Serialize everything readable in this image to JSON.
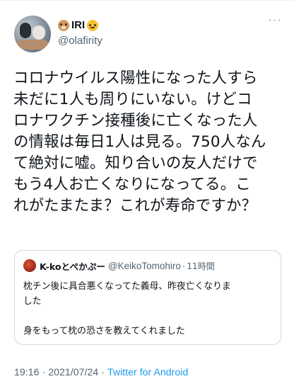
{
  "tweet": {
    "author": {
      "display_name": "IRI",
      "name_emoji_left": "dog-face",
      "name_emoji_right": "cat-face",
      "handle": "@olafirity"
    },
    "more_label": "···",
    "text_lines": [
      "コロナウイルス陽性になった人すら",
      "未だに1人も周りにいない。けどコ",
      "ロナワクチン接種後に亡くなった人",
      "の情報は毎日1人は見る。750人なん",
      "て絶対に嘘。知り合いの友人だけで",
      "もう4人お亡くなりになってる。こ",
      "れがたまたま？これが寿命ですか？"
    ],
    "quote": {
      "display_name": "K-koとぺかぷー",
      "handle": "@KeikoTomohiro",
      "dot": "·",
      "time": "11時間",
      "body_lines": [
        "枕チン後に具合悪くなってた義母、昨夜亡くなりま",
        "した",
        "",
        "身をもって枕の恐さを教えてくれました"
      ]
    },
    "meta": {
      "time": "19:16",
      "separator": "·",
      "date": "2021/07/24",
      "client": "Twitter for Android"
    }
  },
  "colors": {
    "text": "#0f1419",
    "secondary": "#536471",
    "link": "#1d9bf0",
    "border": "#cfd9de"
  }
}
